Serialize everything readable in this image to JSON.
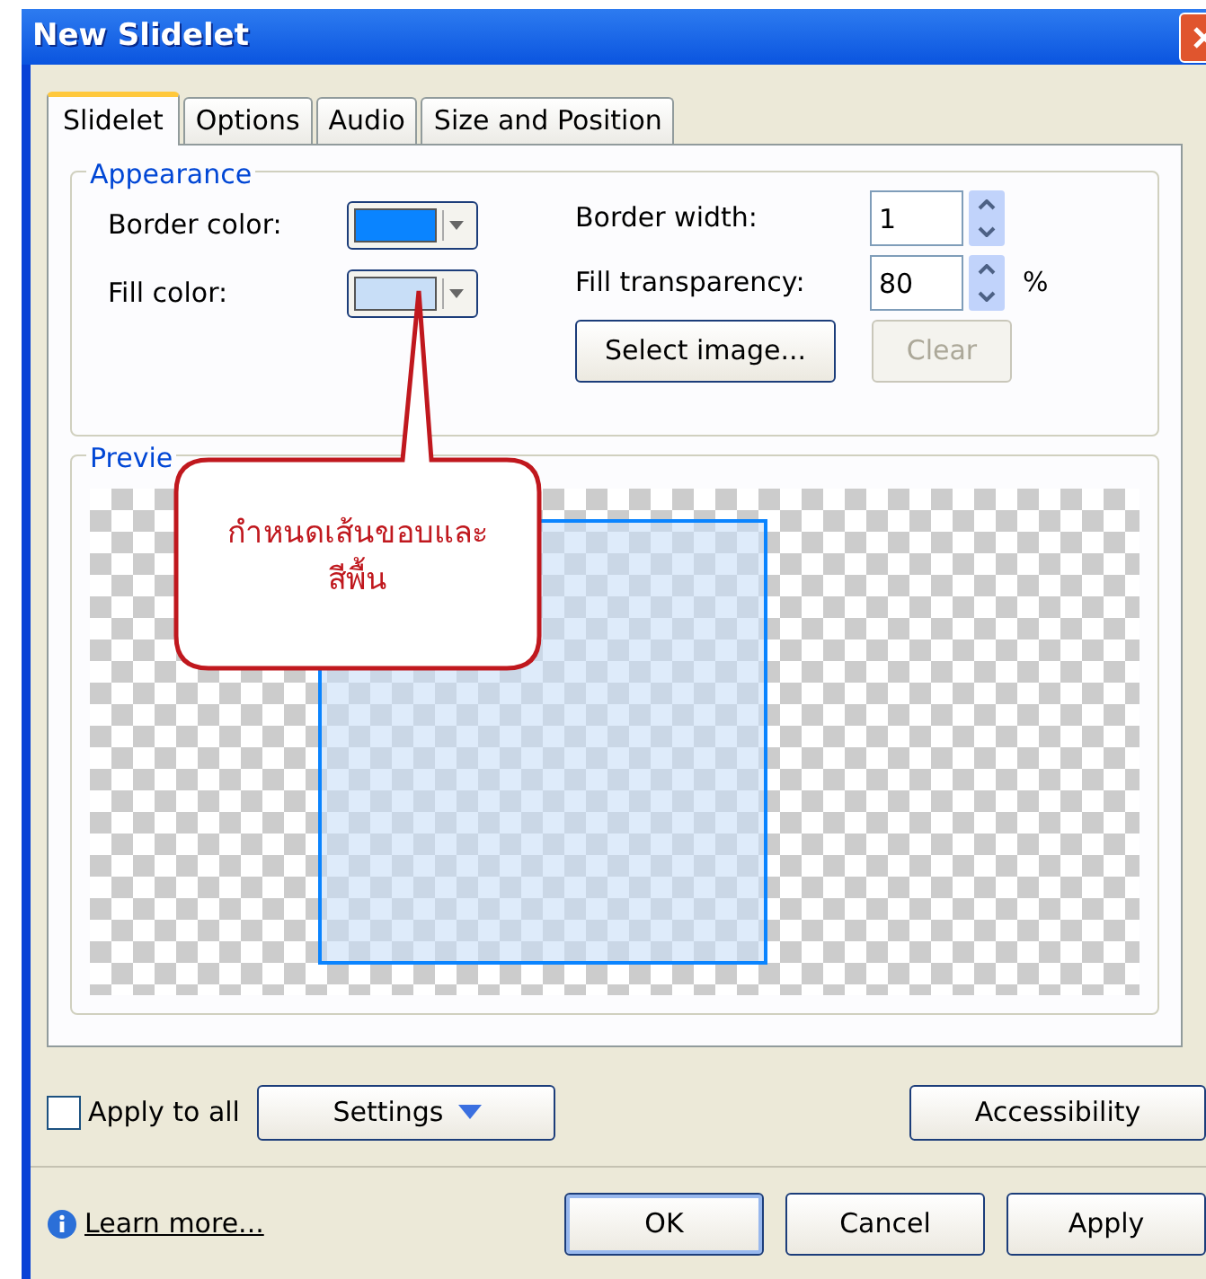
{
  "window": {
    "title": "New Slidelet"
  },
  "tabs": [
    {
      "label": "Slidelet",
      "selected": true
    },
    {
      "label": "Options",
      "selected": false
    },
    {
      "label": "Audio",
      "selected": false
    },
    {
      "label": "Size and Position",
      "selected": false
    }
  ],
  "appearance": {
    "title": "Appearance",
    "border_color": {
      "label": "Border color:",
      "color": "#0a84ff"
    },
    "fill_color": {
      "label": "Fill color:",
      "color": "#c8def7"
    },
    "border_width": {
      "label": "Border width:",
      "value": "1"
    },
    "fill_transparency": {
      "label": "Fill transparency:",
      "value": "80",
      "unit": "%"
    },
    "select_image": {
      "label": "Select image...",
      "disabled": false
    },
    "clear": {
      "label": "Clear",
      "disabled": true
    }
  },
  "preview": {
    "title": "Previe"
  },
  "callout": {
    "text": "กำหนดเส้นขอบและ\nสีพื้น"
  },
  "apply_to_all": {
    "label": "Apply to all",
    "checked": false
  },
  "settings": {
    "label": "Settings"
  },
  "accessibility": {
    "label": "Accessibility"
  },
  "learn_more": {
    "label": "Learn more..."
  },
  "buttons": [
    {
      "label": "OK",
      "default": true
    },
    {
      "label": "Cancel",
      "default": false
    },
    {
      "label": "Apply",
      "default": false
    }
  ]
}
